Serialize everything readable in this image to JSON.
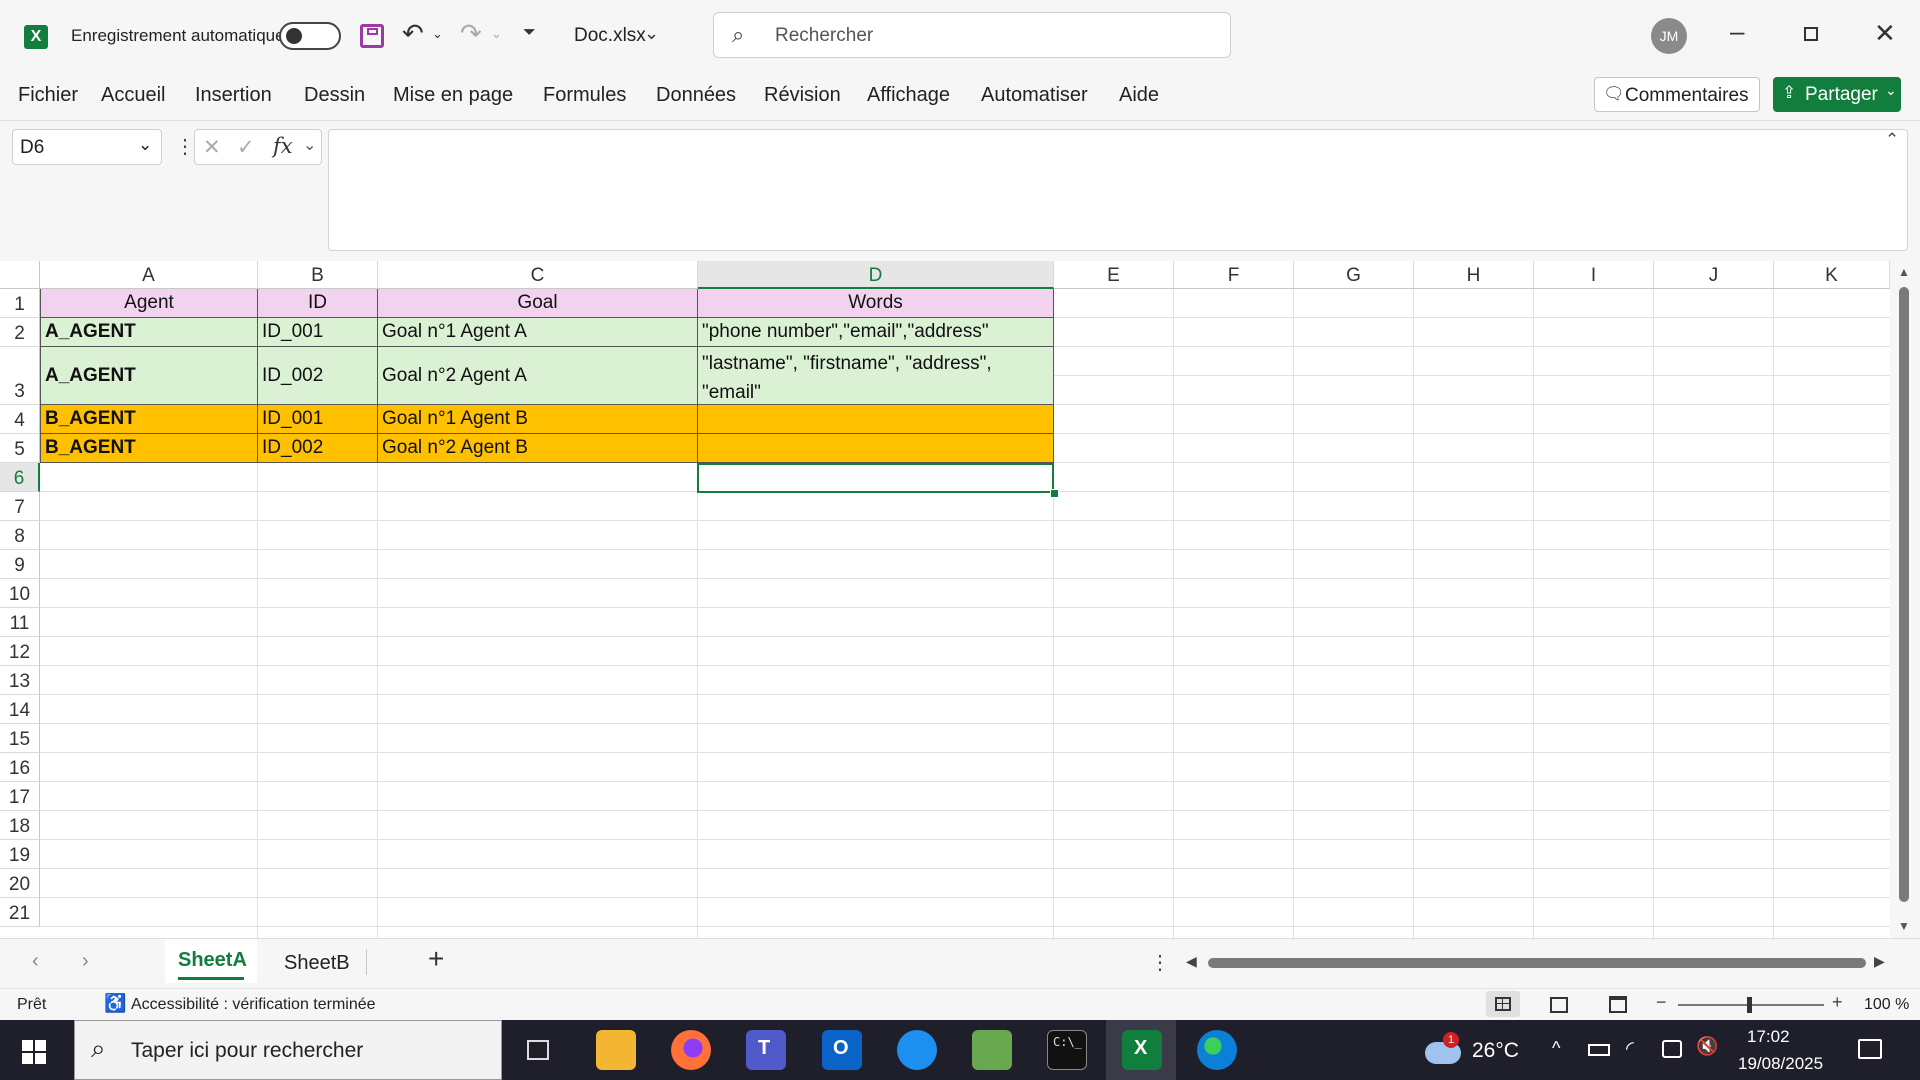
{
  "titlebar": {
    "autosave_label": "Enregistrement automatique",
    "filename": "Doc.xlsx",
    "search_placeholder": "Rechercher",
    "avatar_initials": "JM"
  },
  "menu": [
    "Fichier",
    "Accueil",
    "Insertion",
    "Dessin",
    "Mise en page",
    "Formules",
    "Données",
    "Révision",
    "Affichage",
    "Automatiser",
    "Aide"
  ],
  "actions": {
    "comments": "Commentaires",
    "share": "Partager"
  },
  "formula_bar": {
    "name_box": "D6",
    "fx": "fx",
    "content": ""
  },
  "columns": [
    "A",
    "B",
    "C",
    "D",
    "E",
    "F",
    "G",
    "H",
    "I",
    "J",
    "K"
  ],
  "rows": [
    "1",
    "2",
    "3",
    "4",
    "5",
    "6",
    "7",
    "8",
    "9",
    "10",
    "11",
    "12",
    "13",
    "14",
    "15",
    "16",
    "17",
    "18",
    "19",
    "20",
    "21"
  ],
  "table": {
    "header": [
      "Agent",
      "ID",
      "Goal",
      "Words"
    ],
    "rows": [
      [
        "A_AGENT",
        "ID_001",
        "Goal n°1 Agent A",
        "\"phone number\",\"email\",\"address\""
      ],
      [
        "A_AGENT",
        "ID_002",
        "Goal n°2 Agent A",
        "\"lastname\", \"firstname\", \"address\", \"email\""
      ],
      [
        "B_AGENT",
        "ID_001",
        "Goal n°1 Agent B",
        ""
      ],
      [
        "B_AGENT",
        "ID_002",
        "Goal n°2 Agent B",
        ""
      ]
    ]
  },
  "colors": {
    "header_fill": "#f1d3f0",
    "agent_a_fill": "#dbf1d4",
    "agent_b_fill": "#ffc000",
    "excel_green": "#117e3e",
    "selection": "#117e3e"
  },
  "sheets": {
    "tabs": [
      "SheetA",
      "SheetB"
    ],
    "active": "SheetA",
    "add": "+"
  },
  "status": {
    "mode": "Prêt",
    "accessibility": "Accessibilité : vérification terminée",
    "zoom": "100 %"
  },
  "taskbar": {
    "search_placeholder": "Taper ici pour rechercher",
    "weather": "26°C",
    "time": "17:02",
    "date": "19/08/2025",
    "weather_badge": "1"
  }
}
